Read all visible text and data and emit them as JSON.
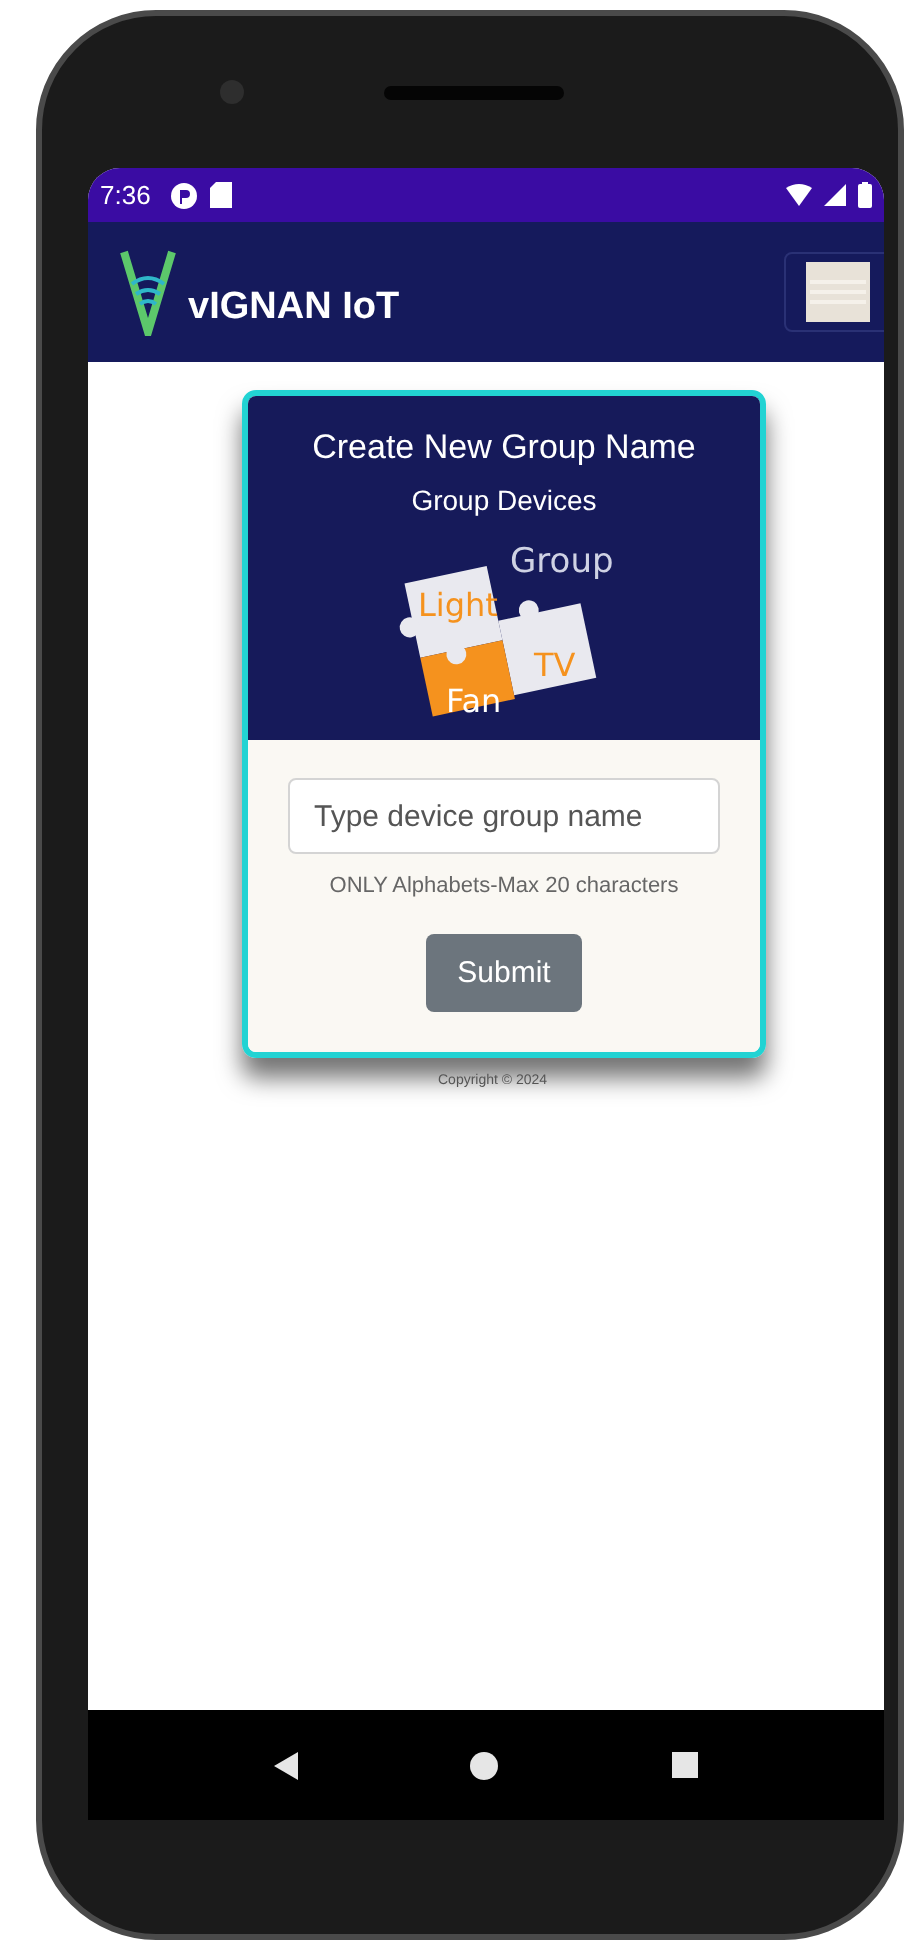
{
  "status_bar": {
    "time": "7:36"
  },
  "app_bar": {
    "title": "vIGNAN IoT"
  },
  "card": {
    "title": "Create New Group Name",
    "subtitle": "Group Devices",
    "illustration": {
      "labels": [
        "Group",
        "Light",
        "TV",
        "Fan"
      ]
    },
    "input": {
      "placeholder": "Type device group name"
    },
    "hint": "ONLY Alphabets-Max 20 characters",
    "button": "Submit"
  },
  "footer": {
    "copyright": "Copyright © 2024"
  }
}
